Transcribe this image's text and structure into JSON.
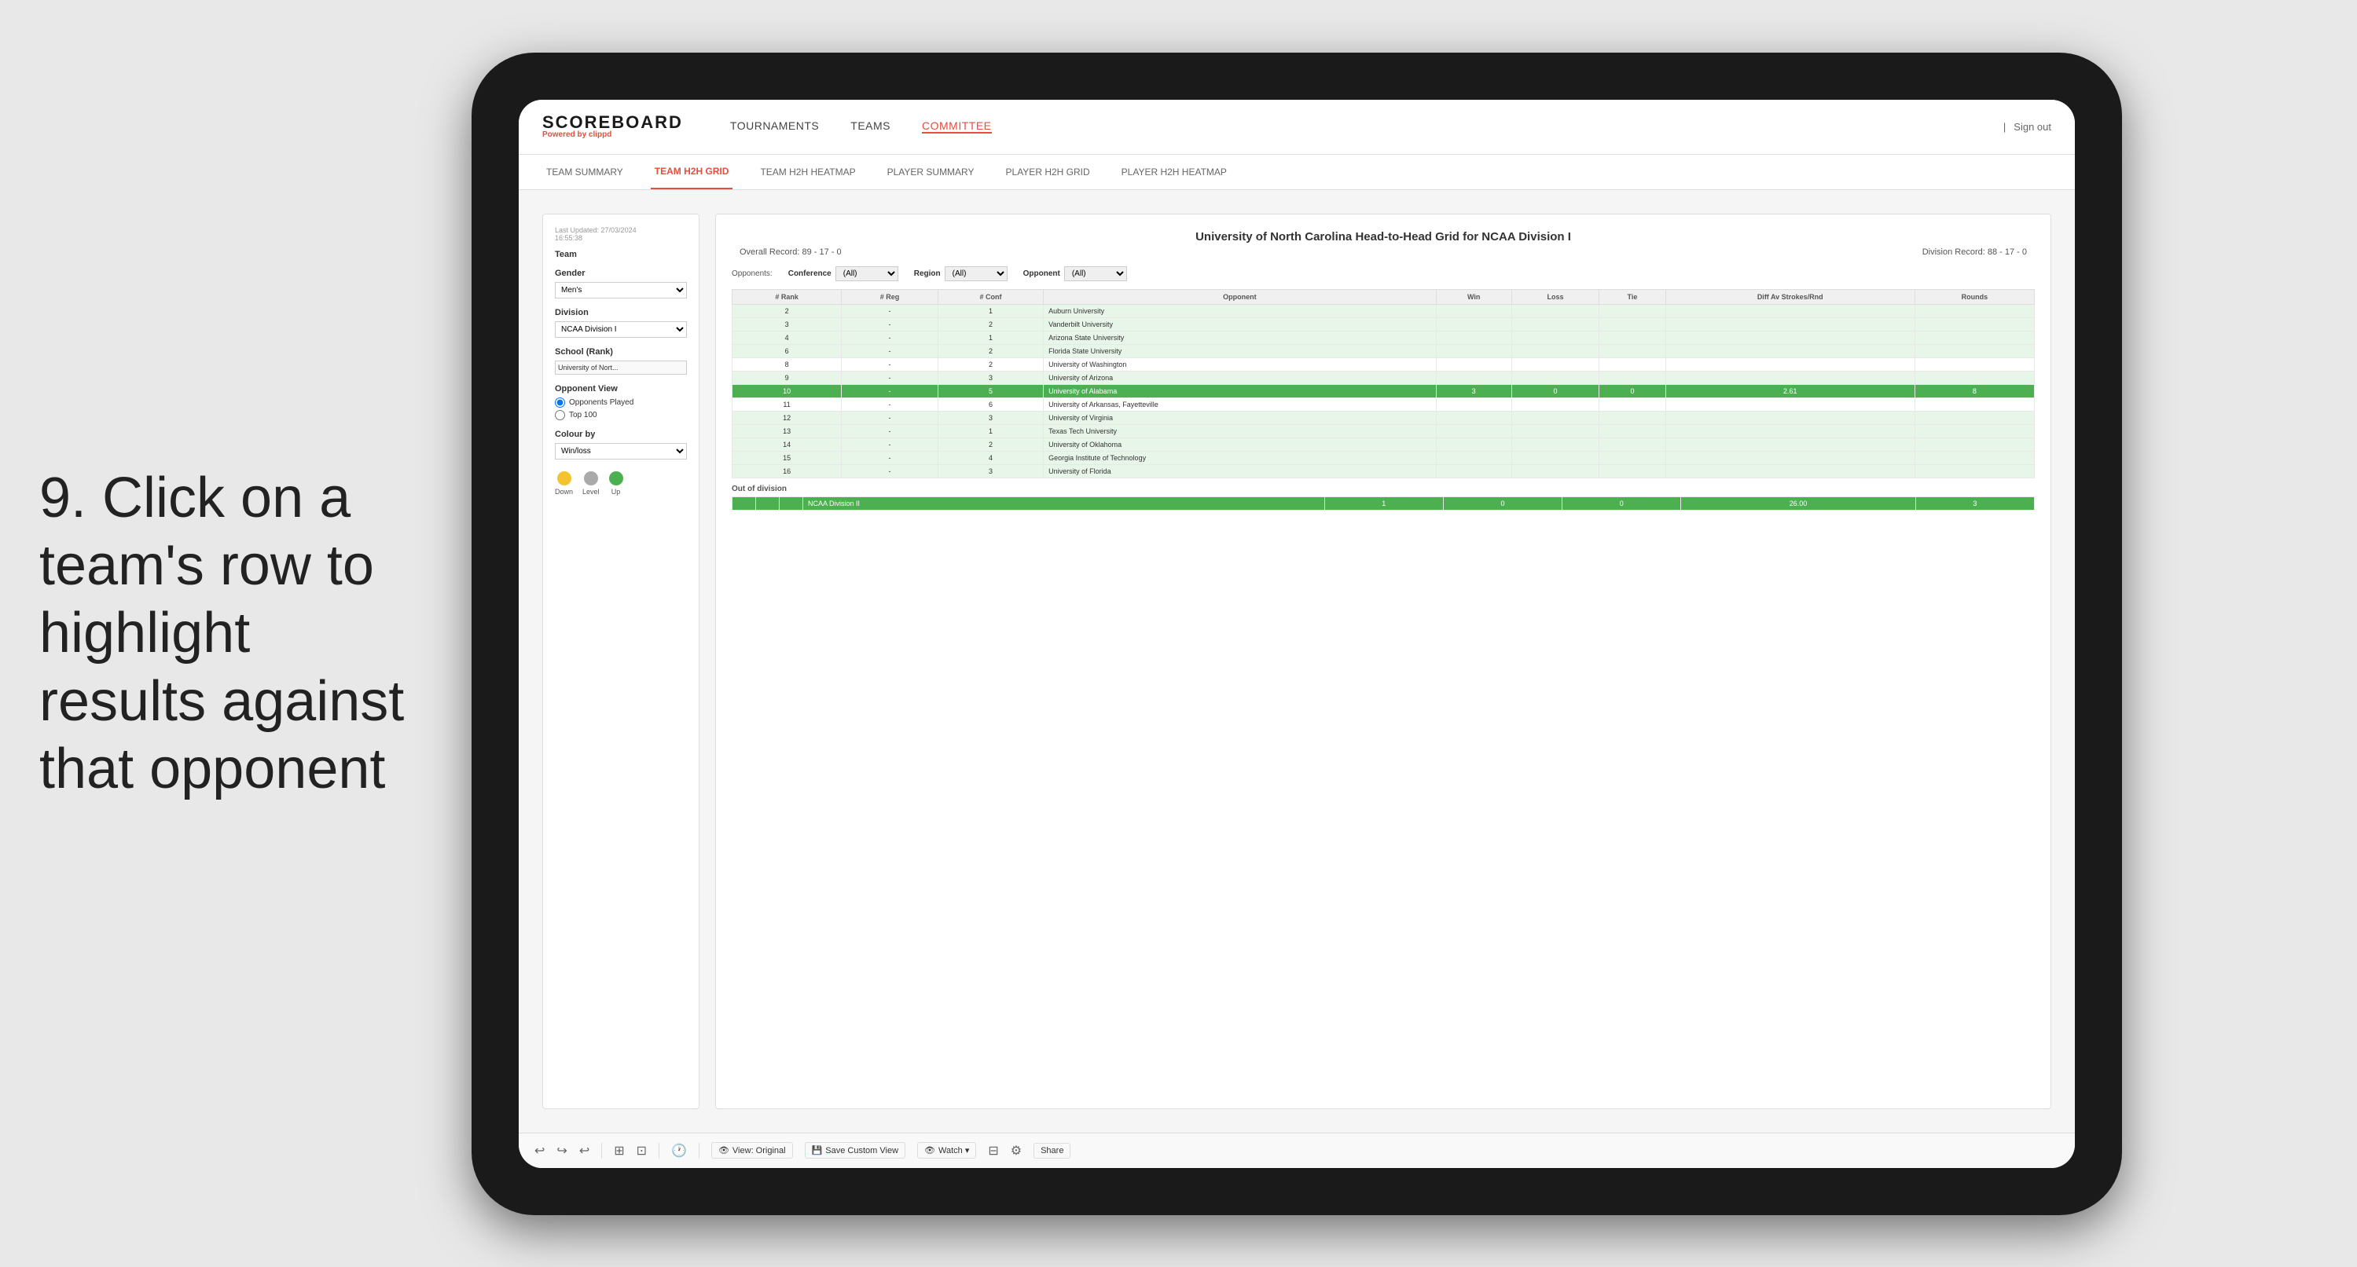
{
  "instruction": {
    "text": "9. Click on a team's row to highlight results against that opponent"
  },
  "app": {
    "logo": "SCOREBOARD",
    "logo_powered": "Powered by",
    "logo_brand": "clippd",
    "sign_out": "Sign out"
  },
  "nav": {
    "items": [
      {
        "label": "TOURNAMENTS",
        "active": false
      },
      {
        "label": "TEAMS",
        "active": false
      },
      {
        "label": "COMMITTEE",
        "active": true
      }
    ]
  },
  "sub_nav": {
    "items": [
      {
        "label": "TEAM SUMMARY",
        "active": false
      },
      {
        "label": "TEAM H2H GRID",
        "active": true
      },
      {
        "label": "TEAM H2H HEATMAP",
        "active": false
      },
      {
        "label": "PLAYER SUMMARY",
        "active": false
      },
      {
        "label": "PLAYER H2H GRID",
        "active": false
      },
      {
        "label": "PLAYER H2H HEATMAP",
        "active": false
      }
    ]
  },
  "sidebar": {
    "timestamp_label": "Last Updated: 27/03/2024",
    "timestamp_time": "16:55:38",
    "team_label": "Team",
    "gender_label": "Gender",
    "gender_value": "Men's",
    "division_label": "Division",
    "division_value": "NCAA Division I",
    "school_label": "School (Rank)",
    "school_value": "University of Nort...",
    "opponent_view_label": "Opponent View",
    "radio_1": "Opponents Played",
    "radio_2": "Top 100",
    "colour_by_label": "Colour by",
    "colour_by_value": "Win/loss",
    "legend_items": [
      {
        "color": "#f4c430",
        "label": "Down"
      },
      {
        "color": "#aaa",
        "label": "Level"
      },
      {
        "color": "#4caf50",
        "label": "Up"
      }
    ]
  },
  "grid": {
    "title": "University of North Carolina Head-to-Head Grid for NCAA Division I",
    "overall_record_label": "Overall Record:",
    "overall_record_value": "89 - 17 - 0",
    "division_record_label": "Division Record:",
    "division_record_value": "88 - 17 - 0",
    "filters": {
      "opponents_label": "Opponents:",
      "conference_label": "Conference",
      "conference_value": "(All)",
      "region_label": "Region",
      "region_value": "(All)",
      "opponent_label": "Opponent",
      "opponent_value": "(All)"
    },
    "table_headers": [
      "# Rank",
      "# Reg",
      "# Conf",
      "Opponent",
      "Win",
      "Loss",
      "Tie",
      "Diff Av Strokes/Rnd",
      "Rounds"
    ],
    "rows": [
      {
        "rank": "2",
        "reg": "-",
        "conf": "1",
        "opponent": "Auburn University",
        "win": "",
        "loss": "",
        "tie": "",
        "diff": "",
        "rounds": "",
        "style": "light-green"
      },
      {
        "rank": "3",
        "reg": "-",
        "conf": "2",
        "opponent": "Vanderbilt University",
        "win": "",
        "loss": "",
        "tie": "",
        "diff": "",
        "rounds": "",
        "style": "light-green"
      },
      {
        "rank": "4",
        "reg": "-",
        "conf": "1",
        "opponent": "Arizona State University",
        "win": "",
        "loss": "",
        "tie": "",
        "diff": "",
        "rounds": "",
        "style": "light-green"
      },
      {
        "rank": "6",
        "reg": "-",
        "conf": "2",
        "opponent": "Florida State University",
        "win": "",
        "loss": "",
        "tie": "",
        "diff": "",
        "rounds": "",
        "style": "light-green"
      },
      {
        "rank": "8",
        "reg": "-",
        "conf": "2",
        "opponent": "University of Washington",
        "win": "",
        "loss": "",
        "tie": "",
        "diff": "",
        "rounds": "",
        "style": "normal"
      },
      {
        "rank": "9",
        "reg": "-",
        "conf": "3",
        "opponent": "University of Arizona",
        "win": "",
        "loss": "",
        "tie": "",
        "diff": "",
        "rounds": "",
        "style": "light-green"
      },
      {
        "rank": "10",
        "reg": "-",
        "conf": "5",
        "opponent": "University of Alabama",
        "win": "3",
        "loss": "0",
        "tie": "0",
        "diff": "2.61",
        "rounds": "8",
        "style": "highlighted"
      },
      {
        "rank": "11",
        "reg": "-",
        "conf": "6",
        "opponent": "University of Arkansas, Fayetteville",
        "win": "",
        "loss": "",
        "tie": "",
        "diff": "",
        "rounds": "",
        "style": "normal"
      },
      {
        "rank": "12",
        "reg": "-",
        "conf": "3",
        "opponent": "University of Virginia",
        "win": "",
        "loss": "",
        "tie": "",
        "diff": "",
        "rounds": "",
        "style": "light-green"
      },
      {
        "rank": "13",
        "reg": "-",
        "conf": "1",
        "opponent": "Texas Tech University",
        "win": "",
        "loss": "",
        "tie": "",
        "diff": "",
        "rounds": "",
        "style": "light-green"
      },
      {
        "rank": "14",
        "reg": "-",
        "conf": "2",
        "opponent": "University of Oklahoma",
        "win": "",
        "loss": "",
        "tie": "",
        "diff": "",
        "rounds": "",
        "style": "light-green"
      },
      {
        "rank": "15",
        "reg": "-",
        "conf": "4",
        "opponent": "Georgia Institute of Technology",
        "win": "",
        "loss": "",
        "tie": "",
        "diff": "",
        "rounds": "",
        "style": "light-green"
      },
      {
        "rank": "16",
        "reg": "-",
        "conf": "3",
        "opponent": "University of Florida",
        "win": "",
        "loss": "",
        "tie": "",
        "diff": "",
        "rounds": "",
        "style": "light-green"
      }
    ],
    "out_of_division_label": "Out of division",
    "out_of_division_row": {
      "label": "NCAA Division II",
      "win": "1",
      "loss": "0",
      "tie": "0",
      "diff": "26.00",
      "rounds": "3"
    }
  },
  "toolbar": {
    "undo": "↩",
    "redo": "↪",
    "view_original": "View: Original",
    "save_custom": "Save Custom View",
    "watch": "Watch ▾",
    "share": "Share"
  }
}
